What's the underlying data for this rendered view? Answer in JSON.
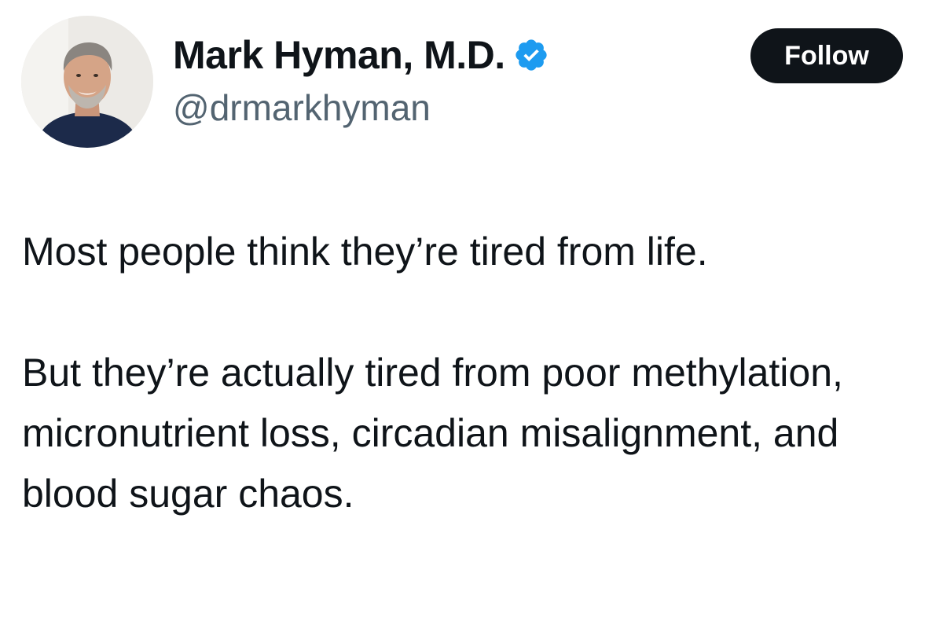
{
  "author": {
    "display_name": "Mark Hyman, M.D.",
    "handle": "@drmarkhyman",
    "verified_icon": "verified-badge-icon",
    "avatar": "profile-photo"
  },
  "actions": {
    "follow_label": "Follow"
  },
  "tweet": {
    "paragraphs": [
      "Most people think they’re tired from life.",
      "But they’re actually tired from poor methylation, micronutrient loss, circadian misalignment, and blood sugar chaos."
    ]
  },
  "colors": {
    "text": "#0f1419",
    "secondary_text": "#536471",
    "verified_blue": "#1d9bf0",
    "button_bg": "#0f1419",
    "button_text": "#ffffff"
  }
}
